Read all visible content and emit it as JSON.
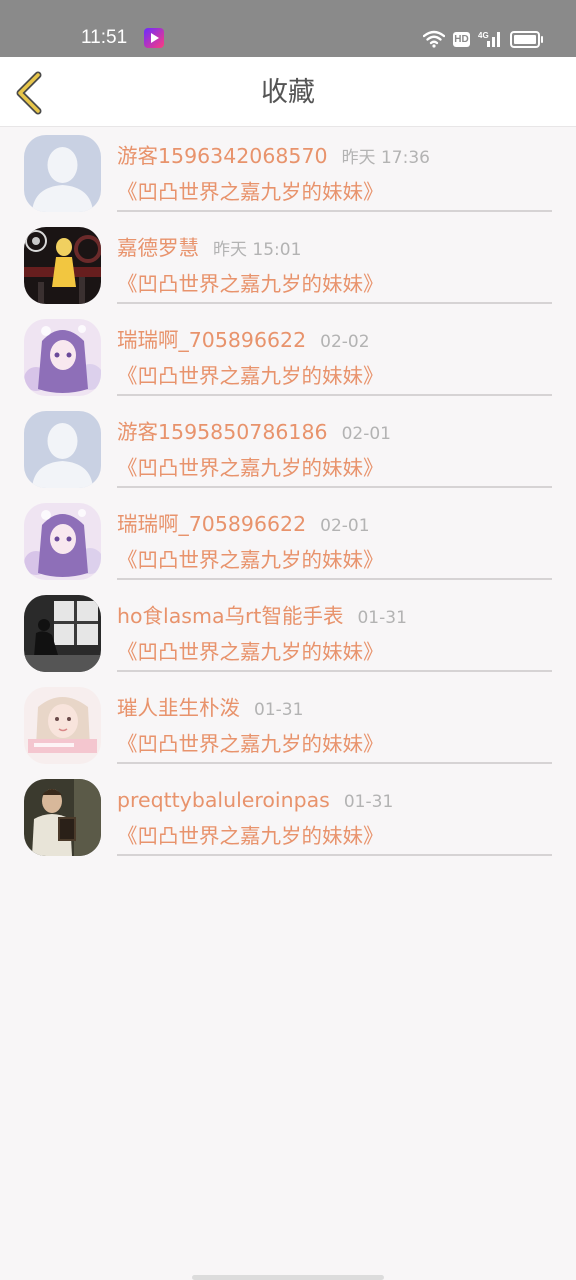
{
  "status_bar": {
    "time": "11:51",
    "hd": "HD",
    "network": "4G"
  },
  "header": {
    "title": "收藏",
    "back_icon": "chevron-left-icon",
    "accent_color": "#e8c64a"
  },
  "colors": {
    "name": "#e8936c",
    "time": "#b3b3b3",
    "background": "#f8f6f7"
  },
  "favorites": [
    {
      "user": "游客1596342068570",
      "time": "昨天 17:36",
      "novel": "《凹凸世界之嘉九岁的妹妹》",
      "avatar": "default-avatar"
    },
    {
      "user": "嘉德罗慧",
      "time": "昨天 15:01",
      "novel": "《凹凸世界之嘉九岁的妹妹》",
      "avatar": "anime-avatar-dark"
    },
    {
      "user": "瑞瑞啊_705896622",
      "time": "02-02",
      "novel": "《凹凸世界之嘉九岁的妹妹》",
      "avatar": "anime-avatar-purple"
    },
    {
      "user": "游客1595850786186",
      "time": "02-01",
      "novel": "《凹凸世界之嘉九岁的妹妹》",
      "avatar": "default-avatar"
    },
    {
      "user": "瑞瑞啊_705896622",
      "time": "02-01",
      "novel": "《凹凸世界之嘉九岁的妹妹》",
      "avatar": "anime-avatar-purple"
    },
    {
      "user": "ho食lasma乌rt智能手表",
      "time": "01-31",
      "novel": "《凹凸世界之嘉九岁的妹妹》",
      "avatar": "photo-avatar-window"
    },
    {
      "user": "璀人韭生朴泼",
      "time": "01-31",
      "novel": "《凹凸世界之嘉九岁的妹妹》",
      "avatar": "photo-avatar-girl"
    },
    {
      "user": "preqttybaluleroinpas",
      "time": "01-31",
      "novel": "《凹凸世界之嘉九岁的妹妹》",
      "avatar": "photo-avatar-reader"
    }
  ]
}
